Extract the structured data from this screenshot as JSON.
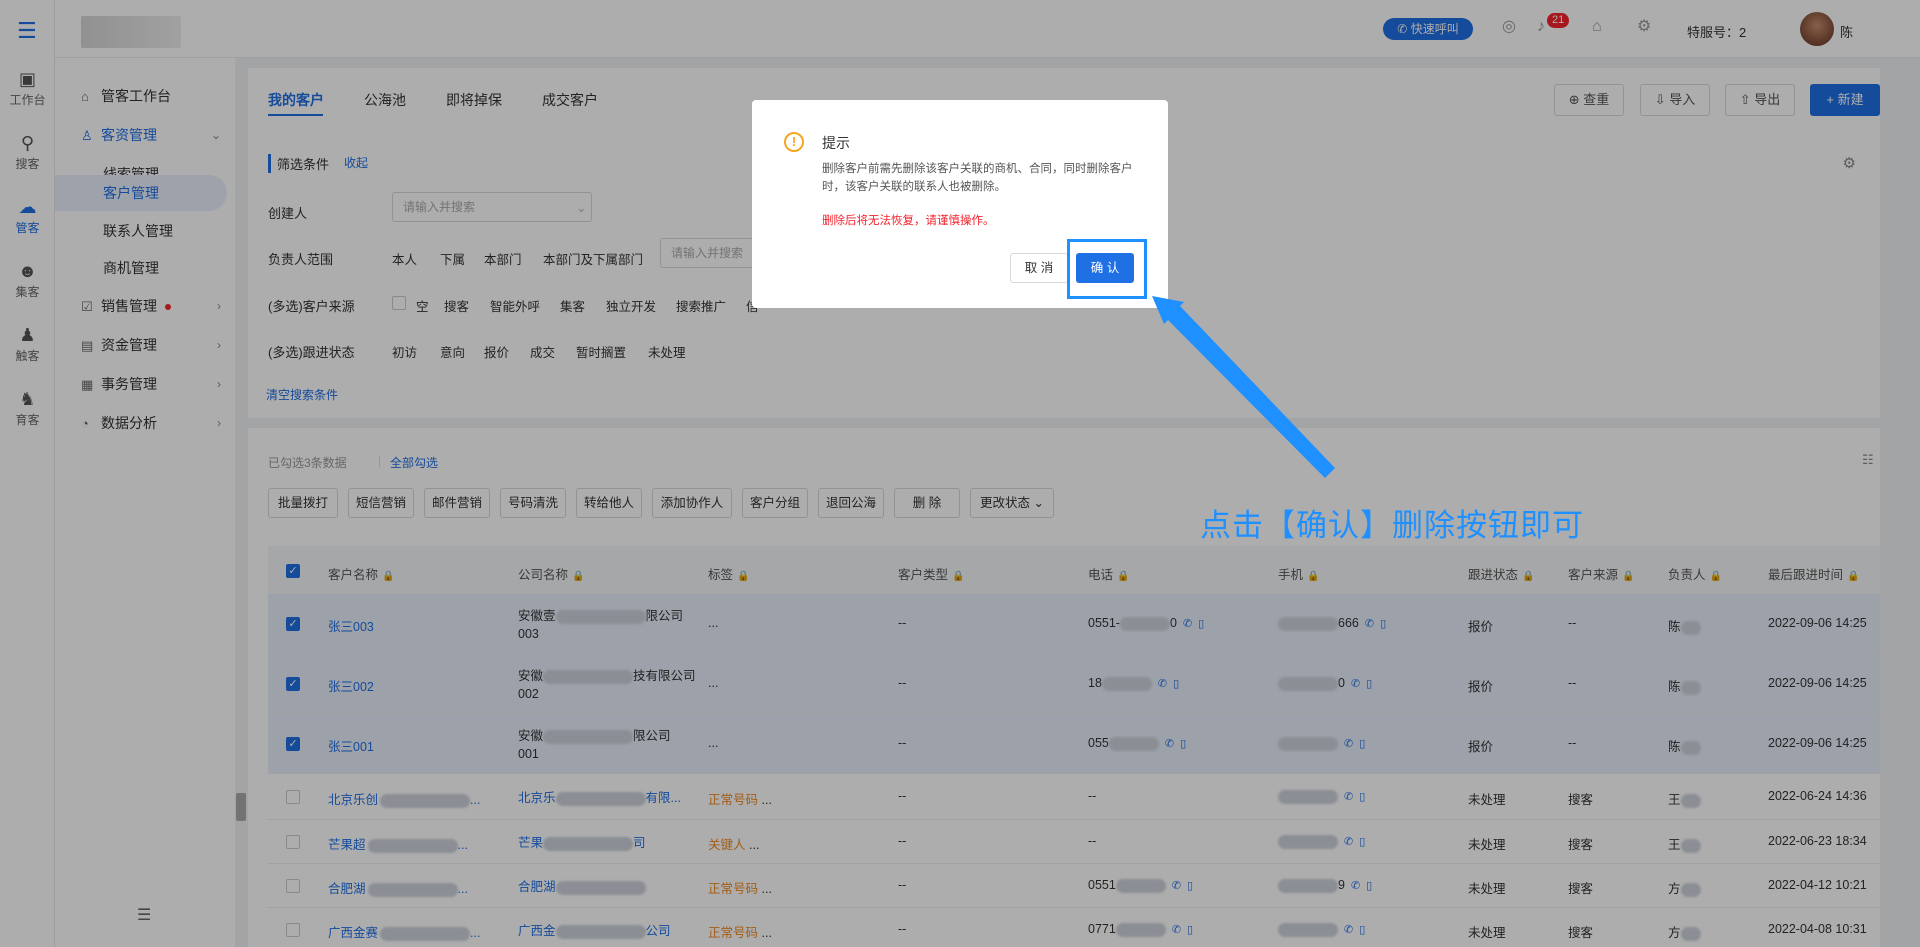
{
  "rail": [
    {
      "label": "工作台",
      "icon": "monitor-icon"
    },
    {
      "label": "搜客",
      "icon": "search-user-icon"
    },
    {
      "label": "管客",
      "icon": "cloud-icon"
    },
    {
      "label": "集客",
      "icon": "group-icon"
    },
    {
      "label": "触客",
      "icon": "touch-user-icon"
    },
    {
      "label": "育客",
      "icon": "nurture-icon"
    }
  ],
  "header": {
    "quick_call": "快速呼叫",
    "badge": "21",
    "tel_label": "特服号：2",
    "user": "陈"
  },
  "sidebar": {
    "workbench": "管客工作台",
    "customer_mgmt": "客资管理",
    "leads": "线索管理",
    "customers": "客户管理",
    "contacts": "联系人管理",
    "opportunities": "商机管理",
    "sales": "销售管理",
    "funds": "资金管理",
    "affairs": "事务管理",
    "analytics": "数据分析"
  },
  "tabs": [
    "我的客户",
    "公海池",
    "即将掉保",
    "成交客户"
  ],
  "toolbar": {
    "dedupe": "查重",
    "import": "导入",
    "export": "导出",
    "new": "+ 新建"
  },
  "filters": {
    "title": "筛选条件",
    "collapse": "收起",
    "creator_label": "创建人",
    "creator_placeholder": "请输入并搜索",
    "owner_label": "负责人范围",
    "owner_options": [
      "本人",
      "下属",
      "本部门",
      "本部门及下属部门"
    ],
    "owner_placeholder": "请输入并搜索",
    "source_label": "(多选)客户来源",
    "source_options": [
      "空",
      "搜客",
      "智能外呼",
      "集客",
      "独立开发",
      "搜索推广",
      "信"
    ],
    "status_label": "(多选)跟进状态",
    "status_options": [
      "初访",
      "意向",
      "报价",
      "成交",
      "暂时搁置",
      "未处理"
    ],
    "clear": "清空搜索条件"
  },
  "selection": {
    "text": "已勾选3条数据",
    "select_all": "全部勾选"
  },
  "batch_buttons": [
    "批量拨打",
    "短信营销",
    "邮件营销",
    "号码清洗",
    "转给他人",
    "添加协作人",
    "客户分组",
    "退回公海",
    "删 除",
    "更改状态"
  ],
  "columns": [
    "客户名称",
    "公司名称",
    "标签",
    "客户类型",
    "电话",
    "手机",
    "跟进状态",
    "客户来源",
    "负责人",
    "最后跟进时间"
  ],
  "rows": [
    {
      "checked": true,
      "name": "张三003",
      "company": "安徽壹",
      "company_tail": "限公司",
      "company_line2": "003",
      "tag": "...",
      "type": "--",
      "phone": "0551-",
      "phone_tail": "0",
      "mobile_tail": "666",
      "status": "报价",
      "source": "--",
      "owner": "陈",
      "time": "2022-09-06 14:25"
    },
    {
      "checked": true,
      "name": "张三002",
      "company": "安徽",
      "company_tail": "技有限公司",
      "company_line2": "002",
      "tag": "...",
      "type": "--",
      "phone": "18",
      "phone_tail": "",
      "mobile_tail": "0",
      "status": "报价",
      "source": "--",
      "owner": "陈",
      "time": "2022-09-06 14:25"
    },
    {
      "checked": true,
      "name": "张三001",
      "company": "安徽",
      "company_tail": "限公司",
      "company_line2": "001",
      "tag": "...",
      "type": "--",
      "phone": "055",
      "phone_tail": "",
      "mobile_tail": "",
      "status": "报价",
      "source": "--",
      "owner": "陈",
      "time": "2022-09-06 14:25"
    },
    {
      "checked": false,
      "name": "北京乐创",
      "company": "北京乐",
      "company_tail": "有限...",
      "company_line2": "",
      "tag": "正常号码",
      "type": "--",
      "phone": "--",
      "phone_tail": "",
      "mobile_tail": "",
      "status": "未处理",
      "source": "搜客",
      "owner": "王",
      "time": "2022-06-24 14:36"
    },
    {
      "checked": false,
      "name": "芒果超",
      "company": "芒果",
      "company_tail": "司",
      "company_line2": "",
      "tag": "关键人",
      "type": "--",
      "phone": "--",
      "phone_tail": "",
      "mobile_tail": "",
      "status": "未处理",
      "source": "搜客",
      "owner": "王",
      "time": "2022-06-23 18:34"
    },
    {
      "checked": false,
      "name": "合肥湖",
      "company": "合肥湖",
      "company_tail": "",
      "company_line2": "",
      "tag": "正常号码",
      "type": "--",
      "phone": "0551",
      "phone_tail": "",
      "mobile_tail": "9",
      "status": "未处理",
      "source": "搜客",
      "owner": "方",
      "time": "2022-04-12 10:21"
    },
    {
      "checked": false,
      "name": "广西金赛",
      "company": "广西金",
      "company_tail": "公司",
      "company_line2": "",
      "tag": "正常号码",
      "type": "--",
      "phone": "0771",
      "phone_tail": "",
      "mobile_tail": "",
      "status": "未处理",
      "source": "搜客",
      "owner": "方",
      "time": "2022-04-08 10:31"
    }
  ],
  "modal": {
    "title": "提示",
    "body": "删除客户前需先删除该客户关联的商机、合同，同时删除客户时，该客户关联的联系人也被删除。",
    "warning": "删除后将无法恢复，请谨慎操作。",
    "cancel": "取 消",
    "confirm": "确 认"
  },
  "annotation": "点击【确认】删除按钮即可",
  "colors": {
    "accent": "#1f6fe5",
    "annotation": "#1e90ff",
    "warning": "#f5a623",
    "danger": "#f5222d",
    "tag": "#f08a24"
  }
}
